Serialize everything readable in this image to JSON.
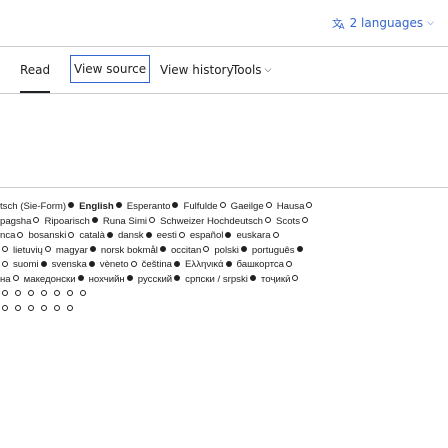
{
  "header": {
    "languages_label": "2 languages"
  },
  "tabs": {
    "read": "Read",
    "view_source": "View source",
    "view_history": "View history",
    "tools": "Tools"
  },
  "languages": [
    [
      {
        "label": "tsch (Sie-Form)",
        "dot": "filled",
        "bold": false
      },
      {
        "label": "English",
        "dot": "filled",
        "bold": true
      },
      {
        "label": "Esperanto",
        "dot": "filled",
        "bold": false
      },
      {
        "label": "Fulfulde",
        "dot": "hollow",
        "bold": false
      },
      {
        "label": "Gaeilge",
        "dot": "hollow",
        "bold": false
      },
      {
        "label": "Hausa",
        "dot": "hollow",
        "bold": false
      }
    ],
    [
      {
        "label": "pagsha",
        "dot": "hollow",
        "bold": false
      },
      {
        "label": "Ripoarisch",
        "dot": "filled",
        "bold": false
      },
      {
        "label": "Runa Simi",
        "dot": "hollow",
        "bold": false
      },
      {
        "label": "Schweizer Hochdeutsch",
        "dot": "hollow",
        "bold": false
      },
      {
        "label": "Scots",
        "dot": "hollow",
        "bold": false
      }
    ],
    [
      {
        "label": "nca",
        "dot": "hollow",
        "bold": false
      },
      {
        "label": "bosanski",
        "dot": "hollow",
        "bold": false
      },
      {
        "label": "català",
        "dot": "filled",
        "bold": false
      },
      {
        "label": "dansk",
        "dot": "filled",
        "bold": false
      },
      {
        "label": "eesti",
        "dot": "hollow",
        "bold": false
      },
      {
        "label": "español",
        "dot": "filled",
        "bold": false
      },
      {
        "label": "euskara",
        "dot": "hollow",
        "bold": false
      }
    ],
    [
      {
        "label": "",
        "dot": "hollow",
        "bold": false
      },
      {
        "label": "lietuvių",
        "dot": "hollow",
        "bold": false
      },
      {
        "label": "magyar",
        "dot": "filled",
        "bold": false
      },
      {
        "label": "norsk bokmål",
        "dot": "filled",
        "bold": false
      },
      {
        "label": "occitan",
        "dot": "hollow",
        "bold": false
      },
      {
        "label": "polski",
        "dot": "filled",
        "bold": false
      },
      {
        "label": "português",
        "dot": "filled",
        "bold": false
      }
    ],
    [
      {
        "label": "",
        "dot": "hollow",
        "bold": false
      },
      {
        "label": "suomi",
        "dot": "filled",
        "bold": false
      },
      {
        "label": "svenska",
        "dot": "filled",
        "bold": false
      },
      {
        "label": "vèneto",
        "dot": "hollow",
        "bold": false
      },
      {
        "label": "čeština",
        "dot": "filled",
        "bold": false
      },
      {
        "label": "Ελληνικά",
        "dot": "filled",
        "bold": false
      },
      {
        "label": "башкортса",
        "dot": "hollow",
        "bold": false
      }
    ],
    [
      {
        "label": "на",
        "dot": "hollow",
        "bold": false
      },
      {
        "label": "македонски",
        "dot": "filled",
        "bold": false
      },
      {
        "label": "нохчийн",
        "dot": "filled",
        "bold": false
      },
      {
        "label": "русский",
        "dot": "filled",
        "bold": false
      },
      {
        "label": "српски / srpski",
        "dot": "filled",
        "bold": false
      },
      {
        "label": "тоҷикӣ",
        "dot": "hollow",
        "bold": false
      }
    ],
    [
      {
        "label": "",
        "dot": "hollow",
        "bold": false
      },
      {
        "label": "",
        "dot": "hollow",
        "bold": false
      },
      {
        "label": "",
        "dot": "hollow",
        "bold": false
      },
      {
        "label": "",
        "dot": "hollow",
        "bold": false
      },
      {
        "label": "",
        "dot": "hollow",
        "bold": false
      },
      {
        "label": "",
        "dot": "hollow",
        "bold": false
      },
      {
        "label": "",
        "dot": "hollow",
        "bold": false
      }
    ],
    [
      {
        "label": "",
        "dot": "hollow",
        "bold": false
      },
      {
        "label": "",
        "dot": "hollow",
        "bold": false
      },
      {
        "label": "",
        "dot": "hollow",
        "bold": false
      },
      {
        "label": "",
        "dot": "hollow",
        "bold": false
      },
      {
        "label": "",
        "dot": "hollow",
        "bold": false
      },
      {
        "label": "",
        "dot": "hollow",
        "bold": false
      }
    ]
  ]
}
